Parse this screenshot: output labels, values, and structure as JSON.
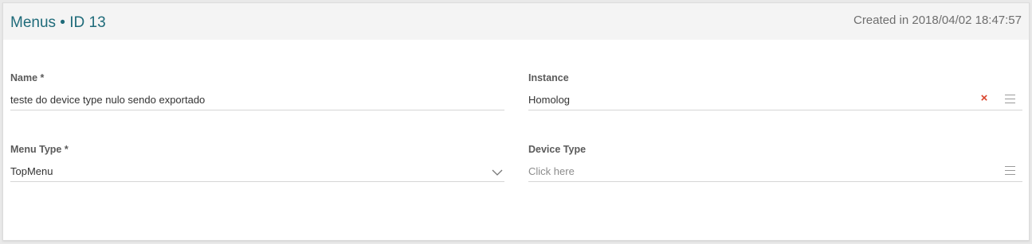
{
  "header": {
    "title": "Menus • ID 13",
    "created": "Created in 2018/04/02 18:47:57"
  },
  "form": {
    "name": {
      "label": "Name *",
      "value": "teste do device type nulo sendo exportado"
    },
    "instance": {
      "label": "Instance",
      "value": "Homolog",
      "clear_glyph": "×"
    },
    "menu_type": {
      "label": "Menu Type *",
      "value": "TopMenu"
    },
    "device_type": {
      "label": "Device Type",
      "placeholder": "Click here"
    }
  },
  "icons": {
    "clear": "close-icon",
    "list": "list-icon",
    "dropdown": "chevron-down-icon"
  },
  "colors": {
    "title": "#1f6b7a",
    "header_bg": "#f4f4f4",
    "clear_icon": "#d9442c",
    "label": "#5a5a5a"
  }
}
